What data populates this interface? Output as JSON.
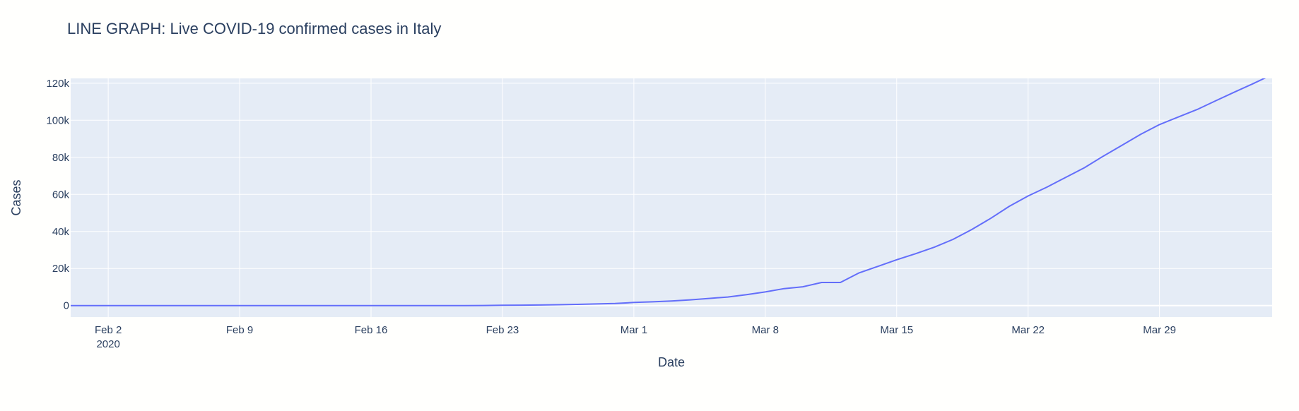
{
  "chart_data": {
    "type": "line",
    "title": "LINE GRAPH: Live COVID-19 confirmed cases in Italy",
    "xlabel": "Date",
    "ylabel": "Cases",
    "x_range": [
      "2020-01-31",
      "2020-04-04"
    ],
    "ylim": [
      -6200,
      122600
    ],
    "y_ticks": [
      0,
      20000,
      40000,
      60000,
      80000,
      100000,
      120000
    ],
    "y_tick_labels": [
      "0",
      "20k",
      "40k",
      "60k",
      "80k",
      "100k",
      "120k"
    ],
    "x_ticks": [
      "2020-02-02",
      "2020-02-09",
      "2020-02-16",
      "2020-02-23",
      "2020-03-01",
      "2020-03-08",
      "2020-03-15",
      "2020-03-22",
      "2020-03-29"
    ],
    "x_tick_labels": [
      "Feb 2",
      "Feb 9",
      "Feb 16",
      "Feb 23",
      "Mar 1",
      "Mar 8",
      "Mar 15",
      "Mar 22",
      "Mar 29"
    ],
    "x_tick_year": "2020",
    "grid": true,
    "legend": "none",
    "colors": {
      "line": "#636efa",
      "plot_bg": "#e5ecf6",
      "paper_bg": "#fffffd",
      "grid": "#ffffff",
      "text": "#2a3f5f"
    },
    "series": [
      {
        "x": [
          "2020-01-31",
          "2020-02-01",
          "2020-02-02",
          "2020-02-03",
          "2020-02-04",
          "2020-02-05",
          "2020-02-06",
          "2020-02-07",
          "2020-02-08",
          "2020-02-09",
          "2020-02-10",
          "2020-02-11",
          "2020-02-12",
          "2020-02-13",
          "2020-02-14",
          "2020-02-15",
          "2020-02-16",
          "2020-02-17",
          "2020-02-18",
          "2020-02-19",
          "2020-02-20",
          "2020-02-21",
          "2020-02-22",
          "2020-02-23",
          "2020-02-24",
          "2020-02-25",
          "2020-02-26",
          "2020-02-27",
          "2020-02-28",
          "2020-02-29",
          "2020-03-01",
          "2020-03-02",
          "2020-03-03",
          "2020-03-04",
          "2020-03-05",
          "2020-03-06",
          "2020-03-07",
          "2020-03-08",
          "2020-03-09",
          "2020-03-10",
          "2020-03-11",
          "2020-03-12",
          "2020-03-13",
          "2020-03-14",
          "2020-03-15",
          "2020-03-16",
          "2020-03-17",
          "2020-03-18",
          "2020-03-19",
          "2020-03-20",
          "2020-03-21",
          "2020-03-22",
          "2020-03-23",
          "2020-03-24",
          "2020-03-25",
          "2020-03-26",
          "2020-03-27",
          "2020-03-28",
          "2020-03-29",
          "2020-03-30",
          "2020-03-31",
          "2020-04-01",
          "2020-04-02",
          "2020-04-03",
          "2020-04-04"
        ],
        "values": [
          2,
          2,
          2,
          2,
          2,
          2,
          2,
          3,
          3,
          3,
          3,
          3,
          3,
          3,
          3,
          3,
          3,
          3,
          3,
          3,
          3,
          20,
          62,
          155,
          229,
          322,
          453,
          655,
          888,
          1128,
          1694,
          2036,
          2502,
          3089,
          3858,
          4636,
          5883,
          7375,
          9172,
          10149,
          12462,
          12462,
          17660,
          21157,
          24747,
          27980,
          31506,
          35713,
          41035,
          47021,
          53578,
          59138,
          63927,
          69176,
          74386,
          80589,
          86498,
          92472,
          97689,
          101739,
          105792,
          110574,
          115242,
          119827,
          124632
        ]
      }
    ]
  }
}
